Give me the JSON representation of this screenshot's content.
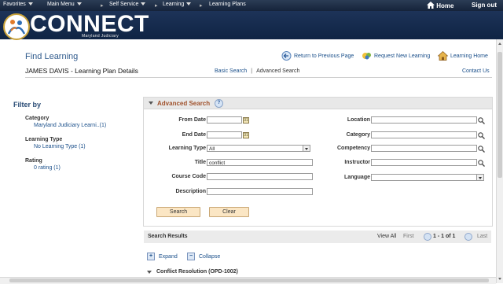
{
  "topnav": {
    "favorites": "Favorites",
    "main_menu": "Main Menu",
    "self_service": "Self Service",
    "learning": "Learning",
    "learning_plans": "Learning Plans",
    "home": "Home",
    "sign_out": "Sign out"
  },
  "branding": {
    "logo_text": "CONNECT",
    "logo_sub": "Maryland Judiciary"
  },
  "page": {
    "title": "Find Learning",
    "subtitle": "JAMES DAVIS   - Learning Plan Details",
    "return_link": "Return to Previous Page",
    "request_link": "Request New Learning",
    "home_link": "Learning Home",
    "basic_search": "Basic Search",
    "link_sep": "|",
    "advanced_search": "Advanced Search",
    "contact": "Contact Us"
  },
  "filters": {
    "title": "Filter by",
    "groups": [
      {
        "heading": "Category",
        "value": "Maryland Judiciary Learni..(1)"
      },
      {
        "heading": "Learning Type",
        "value": "No Learning Type (1)"
      },
      {
        "heading": "Rating",
        "value": "0 rating (1)"
      }
    ]
  },
  "advanced": {
    "header": "Advanced Search",
    "help": "?",
    "left_fields": {
      "from_date": {
        "label": "From Date",
        "value": ""
      },
      "end_date": {
        "label": "End Date",
        "value": ""
      },
      "learning_type": {
        "label": "Learning Type",
        "value": "All"
      },
      "title": {
        "label": "Title",
        "value": "conflict"
      },
      "course_code": {
        "label": "Course Code",
        "value": ""
      },
      "description": {
        "label": "Description",
        "value": ""
      }
    },
    "right_fields": {
      "location": {
        "label": "Location",
        "value": ""
      },
      "category": {
        "label": "Category",
        "value": ""
      },
      "competency": {
        "label": "Competency",
        "value": ""
      },
      "instructor": {
        "label": "Instructor",
        "value": ""
      },
      "language": {
        "label": "Language",
        "value": ""
      }
    },
    "search_btn": "Search",
    "clear_btn": "Clear"
  },
  "results": {
    "title": "Search Results",
    "view_all": "View All",
    "first": "First",
    "range": "1 - 1 of 1",
    "last": "Last",
    "expand": "Expand",
    "collapse": "Collapse",
    "group": "Conflict Resolution (OPD-1002)"
  },
  "colors": {
    "nav": "#1d3358",
    "accent_link": "#1a4f8a",
    "section_title": "#a0522d",
    "button_fill": "#fbe6c4"
  }
}
